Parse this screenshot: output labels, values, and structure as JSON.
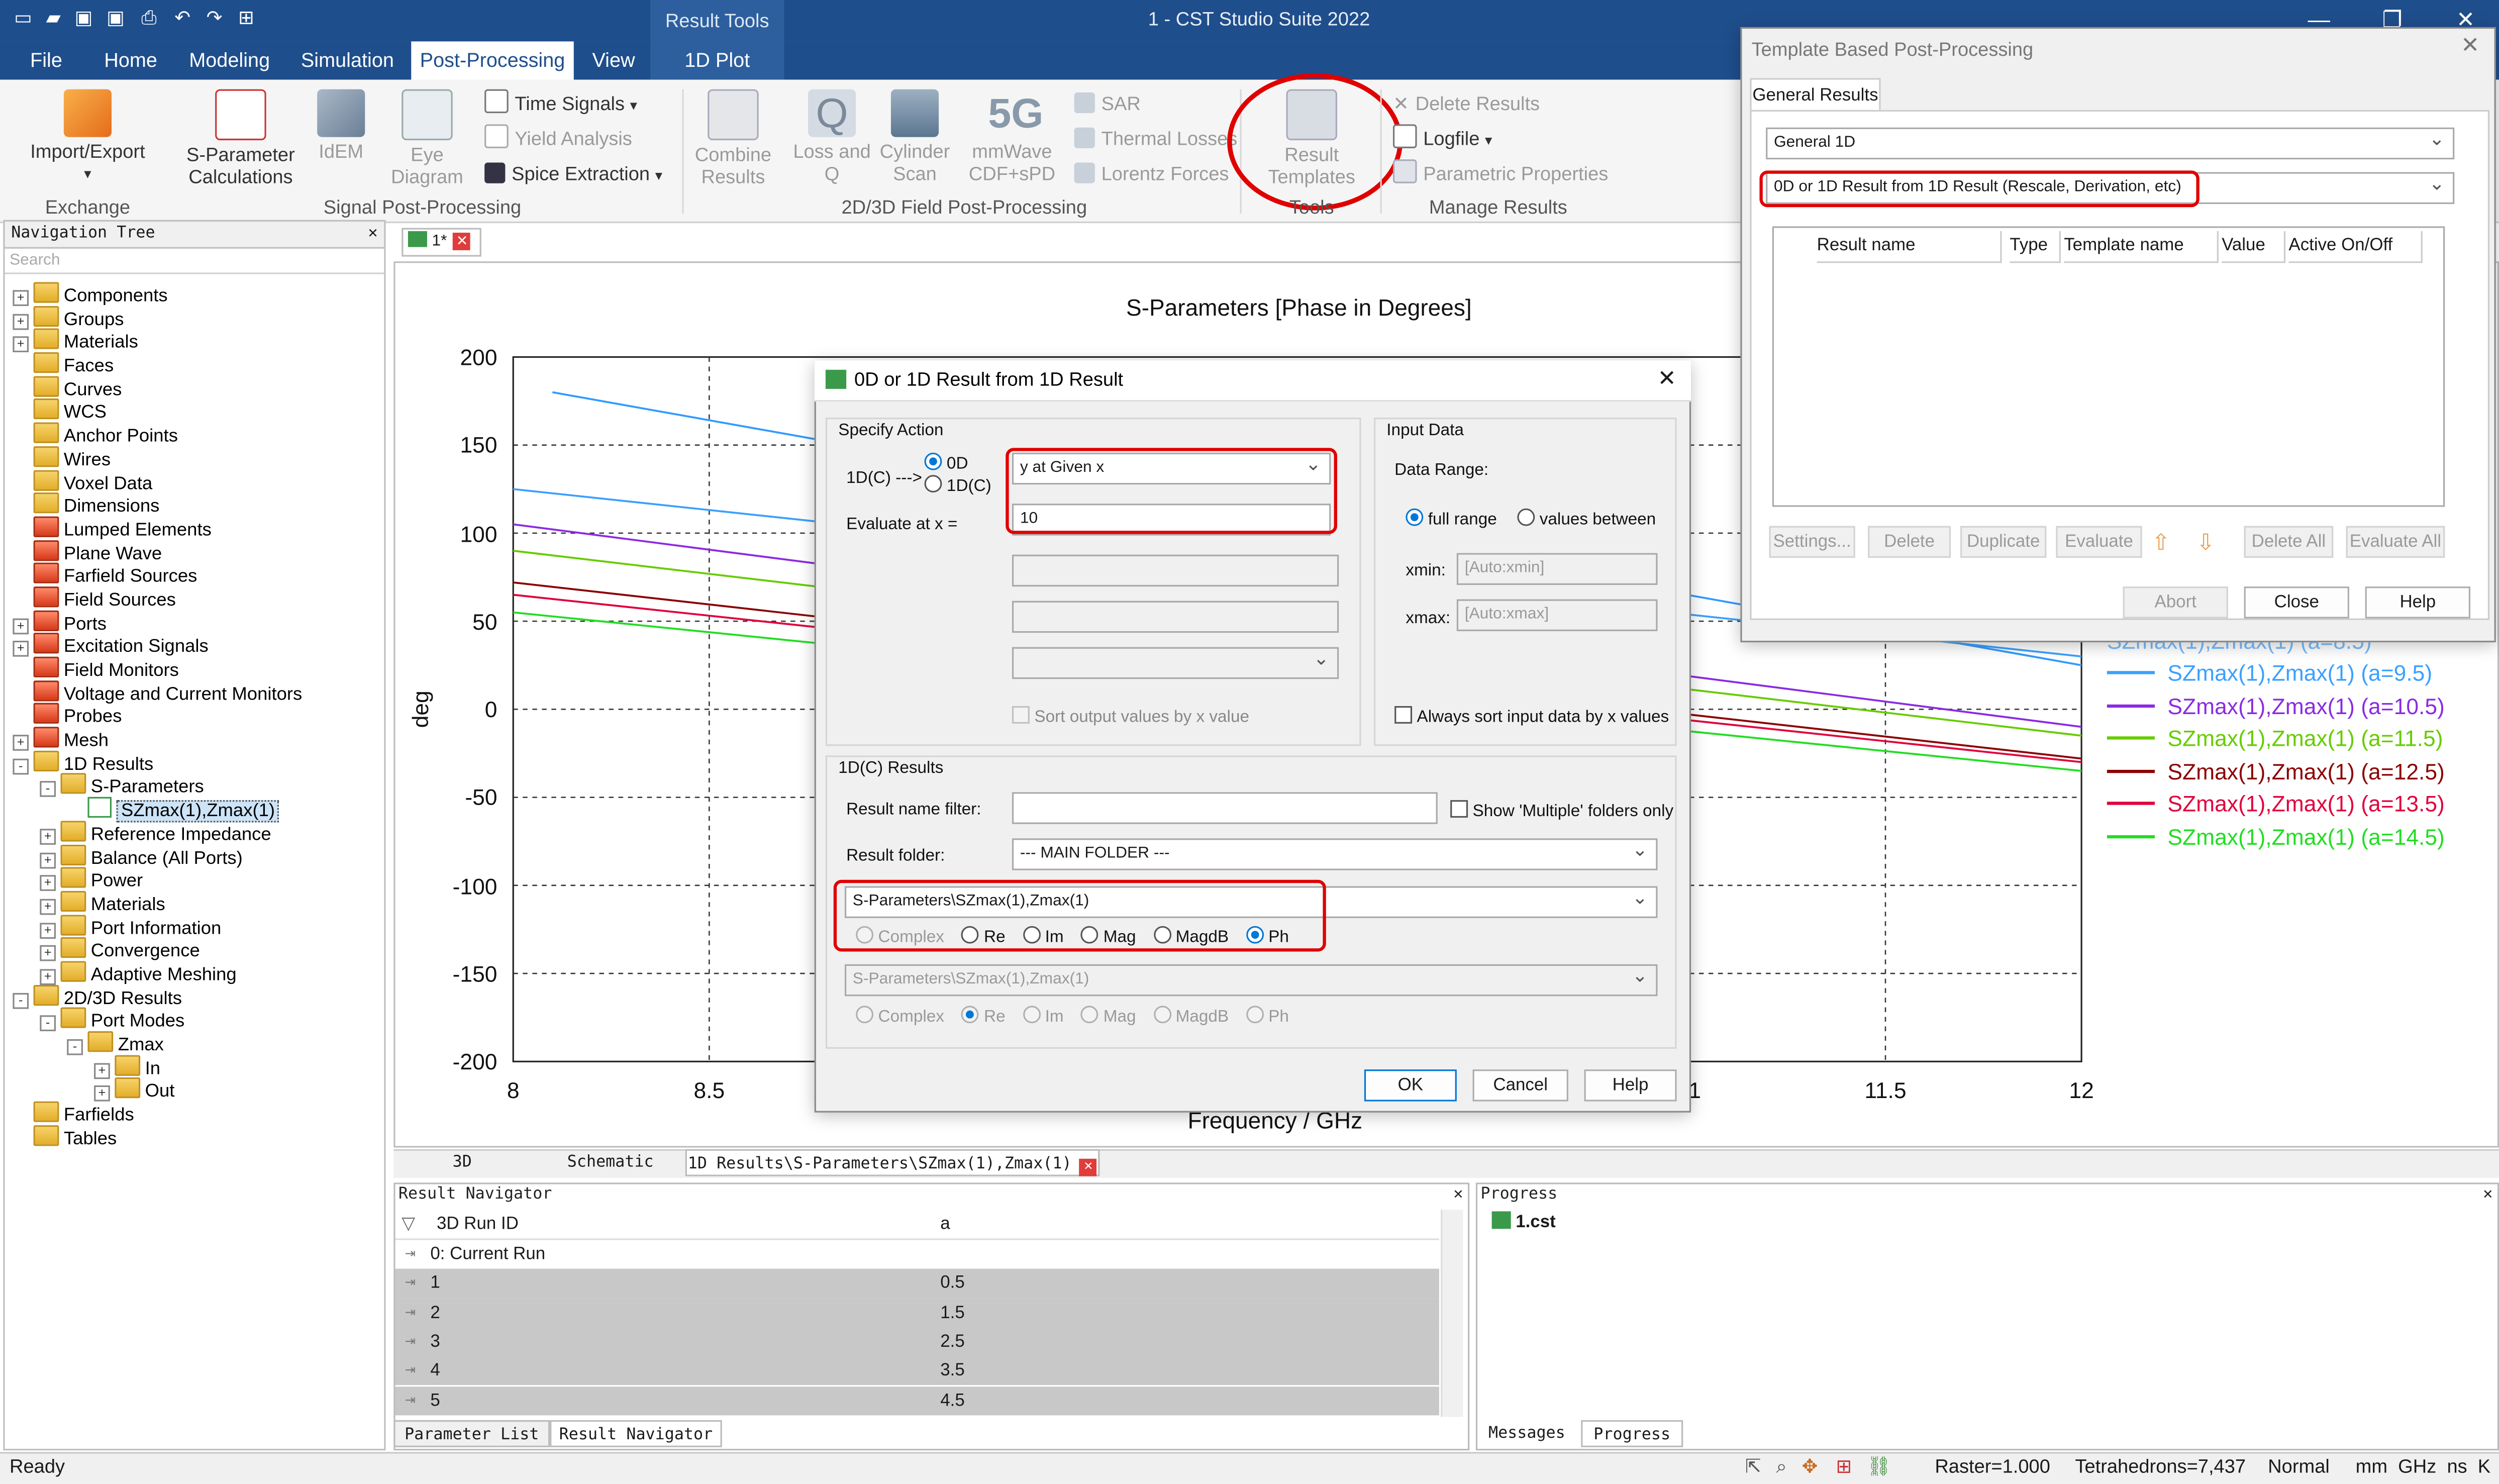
{
  "app": {
    "title": "1 - CST Studio Suite 2022",
    "context_tools": "Result Tools",
    "window_controls": [
      "minimize-icon",
      "maximize-icon",
      "close-icon"
    ]
  },
  "menu_tabs": [
    "File",
    "Home",
    "Modeling",
    "Simulation",
    "Post-Processing",
    "View",
    "1D Plot"
  ],
  "ribbon": {
    "import_export": "Import/Export",
    "s_param": "S-Parameter",
    "s_param2": "Calculations",
    "idem": "IdEM",
    "eye1": "Eye",
    "eye2": "Diagram",
    "time_signals": "Time Signals",
    "yield_analysis": "Yield Analysis",
    "spice_extraction": "Spice Extraction",
    "combine1": "Combine",
    "combine2": "Results",
    "loss1": "Loss and",
    "loss2": "Q",
    "cyl1": "Cylinder",
    "cyl2": "Scan",
    "mmwave1": "mmWave",
    "mmwave2": "CDF+sPD",
    "sar": "SAR",
    "thermal_losses": "Thermal Losses",
    "lorentz_forces": "Lorentz Forces",
    "result_templates1": "Result",
    "result_templates2": "Templates",
    "delete_results": "Delete Results",
    "logfile": "Logfile",
    "parametric_properties": "Parametric Properties",
    "groups": {
      "exchange": "Exchange",
      "signal_pp": "Signal Post-Processing",
      "field_pp": "2D/3D Field Post-Processing",
      "tools": "Tools",
      "manage": "Manage Results"
    },
    "icon_5g": "5G"
  },
  "nav_tree": {
    "title": "Navigation Tree",
    "search_placeholder": "Search",
    "items": [
      {
        "label": "Components",
        "level": 0,
        "exp": "+",
        "icon": "folder"
      },
      {
        "label": "Groups",
        "level": 0,
        "exp": "+",
        "icon": "folder"
      },
      {
        "label": "Materials",
        "level": 0,
        "exp": "+",
        "icon": "folder"
      },
      {
        "label": "Faces",
        "level": 0,
        "exp": "",
        "icon": "folder"
      },
      {
        "label": "Curves",
        "level": 0,
        "exp": "",
        "icon": "folder"
      },
      {
        "label": "WCS",
        "level": 0,
        "exp": "",
        "icon": "folder"
      },
      {
        "label": "Anchor Points",
        "level": 0,
        "exp": "",
        "icon": "folder"
      },
      {
        "label": "Wires",
        "level": 0,
        "exp": "",
        "icon": "folder"
      },
      {
        "label": "Voxel Data",
        "level": 0,
        "exp": "",
        "icon": "folder"
      },
      {
        "label": "Dimensions",
        "level": 0,
        "exp": "",
        "icon": "folder"
      },
      {
        "label": "Lumped Elements",
        "level": 0,
        "exp": "",
        "icon": "red"
      },
      {
        "label": "Plane Wave",
        "level": 0,
        "exp": "",
        "icon": "red"
      },
      {
        "label": "Farfield Sources",
        "level": 0,
        "exp": "",
        "icon": "red"
      },
      {
        "label": "Field Sources",
        "level": 0,
        "exp": "",
        "icon": "red"
      },
      {
        "label": "Ports",
        "level": 0,
        "exp": "+",
        "icon": "red"
      },
      {
        "label": "Excitation Signals",
        "level": 0,
        "exp": "+",
        "icon": "red"
      },
      {
        "label": "Field Monitors",
        "level": 0,
        "exp": "",
        "icon": "red"
      },
      {
        "label": "Voltage and Current Monitors",
        "level": 0,
        "exp": "",
        "icon": "red"
      },
      {
        "label": "Probes",
        "level": 0,
        "exp": "",
        "icon": "red"
      },
      {
        "label": "Mesh",
        "level": 0,
        "exp": "+",
        "icon": "red"
      },
      {
        "label": "1D Results",
        "level": 0,
        "exp": "-",
        "icon": "folder"
      },
      {
        "label": "S-Parameters",
        "level": 1,
        "exp": "-",
        "icon": "folder"
      },
      {
        "label": "SZmax(1),Zmax(1)",
        "level": 2,
        "exp": "",
        "icon": "curve",
        "selected": true
      },
      {
        "label": "Reference Impedance",
        "level": 1,
        "exp": "+",
        "icon": "folder"
      },
      {
        "label": "Balance (All Ports)",
        "level": 1,
        "exp": "+",
        "icon": "folder"
      },
      {
        "label": "Power",
        "level": 1,
        "exp": "+",
        "icon": "folder"
      },
      {
        "label": "Materials",
        "level": 1,
        "exp": "+",
        "icon": "folder"
      },
      {
        "label": "Port Information",
        "level": 1,
        "exp": "+",
        "icon": "folder"
      },
      {
        "label": "Convergence",
        "level": 1,
        "exp": "+",
        "icon": "folder"
      },
      {
        "label": "Adaptive Meshing",
        "level": 1,
        "exp": "+",
        "icon": "folder"
      },
      {
        "label": "2D/3D Results",
        "level": 0,
        "exp": "-",
        "icon": "folder"
      },
      {
        "label": "Port Modes",
        "level": 1,
        "exp": "-",
        "icon": "folder"
      },
      {
        "label": "Zmax",
        "level": 2,
        "exp": "-",
        "icon": "folder"
      },
      {
        "label": "In",
        "level": 3,
        "exp": "+",
        "icon": "folder"
      },
      {
        "label": "Out",
        "level": 3,
        "exp": "+",
        "icon": "folder"
      },
      {
        "label": "Farfields",
        "level": 0,
        "exp": "",
        "icon": "folder"
      },
      {
        "label": "Tables",
        "level": 0,
        "exp": "",
        "icon": "folder"
      }
    ]
  },
  "doc_tab": "1*",
  "chart_data": {
    "type": "line",
    "title": "S-Parameters [Phase in Degrees]",
    "xlabel": "Frequency / GHz",
    "ylabel": "deg",
    "xlim": [
      8,
      12
    ],
    "ylim": [
      -200,
      200
    ],
    "x_ticks": [
      "8",
      "8.5",
      "11",
      "11.5",
      "12"
    ],
    "y_ticks": [
      "200",
      "150",
      "100",
      "50",
      "0",
      "-50",
      "-100",
      "-150",
      "-200"
    ],
    "series": [
      {
        "name": "SZmax(1),Zmax(1) (a=8.5)",
        "color": "#2f9bff",
        "x": [
          8.1,
          12
        ],
        "y": [
          180,
          25
        ]
      },
      {
        "name": "SZmax(1),Zmax(1) (a=9.5)",
        "color": "#3aa0ff",
        "x": [
          8,
          12
        ],
        "y": [
          125,
          30
        ]
      },
      {
        "name": "SZmax(1),Zmax(1) (a=10.5)",
        "color": "#8a2be2",
        "x": [
          8,
          12
        ],
        "y": [
          105,
          -10
        ]
      },
      {
        "name": "SZmax(1),Zmax(1) (a=11.5)",
        "color": "#66cc00",
        "x": [
          8,
          12
        ],
        "y": [
          90,
          -15
        ]
      },
      {
        "name": "SZmax(1),Zmax(1) (a=12.5)",
        "color": "#8b0000",
        "x": [
          8,
          12
        ],
        "y": [
          72,
          -28
        ]
      },
      {
        "name": "SZmax(1),Zmax(1) (a=13.5)",
        "color": "#e0003c",
        "x": [
          8,
          12
        ],
        "y": [
          65,
          -30
        ]
      },
      {
        "name": "SZmax(1),Zmax(1) (a=14.5)",
        "color": "#22dd22",
        "x": [
          8,
          12
        ],
        "y": [
          55,
          -35
        ]
      }
    ],
    "legend_position": "right"
  },
  "bottom_tabs": [
    "3D",
    "Schematic",
    "1D Results\\S-Parameters\\SZmax(1),Zmax(1)"
  ],
  "dialog_main": {
    "title": "0D or 1D Result from 1D Result",
    "specify_action": "Specify Action",
    "io_label": "1D(C) --->",
    "opt_0d": "0D",
    "opt_1dc": "1D(C)",
    "action_select": "y at Given x",
    "evaluate_label": "Evaluate at x =",
    "evaluate_value": "10",
    "sort_output": "Sort output values by x value",
    "input_data": "Input Data",
    "data_range": "Data Range:",
    "full_range": "full range",
    "values_between": "values between",
    "xmin_label": "xmin:",
    "xmin_placeholder": "[Auto:xmin]",
    "xmax_label": "xmax:",
    "xmax_placeholder": "[Auto:xmax]",
    "always_sort": "Always sort input data by x values",
    "results_group": "1D(C) Results",
    "name_filter": "Result name filter:",
    "show_multiple": "Show 'Multiple' folders only",
    "result_folder": "Result folder:",
    "result_folder_value": "--- MAIN FOLDER ---",
    "result_1": "S-Parameters\\SZmax(1),Zmax(1)",
    "result_2": "S-Parameters\\SZmax(1),Zmax(1)",
    "complex": "Complex",
    "re": "Re",
    "im": "Im",
    "mag": "Mag",
    "magdb": "MagdB",
    "ph": "Ph",
    "ok": "OK",
    "cancel": "Cancel",
    "help": "Help"
  },
  "dialog_template": {
    "title": "Template Based Post-Processing",
    "tab": "General Results",
    "category_select": "General 1D",
    "template_select": "0D or 1D Result from 1D Result (Rescale, Derivation, etc)",
    "columns": [
      "Result name",
      "Type",
      "Template name",
      "Value",
      "Active On/Off"
    ],
    "buttons": [
      "Settings...",
      "Delete",
      "Duplicate",
      "Evaluate",
      "Delete All",
      "Evaluate All"
    ],
    "abort": "Abort",
    "close": "Close",
    "help": "Help"
  },
  "legend_partial": "SZmax(1),Zmax(1) (a=8.5)",
  "result_navigator": {
    "title": "Result Navigator",
    "columns": [
      "3D Run ID",
      "a"
    ],
    "rows": [
      {
        "id": "0: Current Run",
        "a": "",
        "sel": false
      },
      {
        "id": "1",
        "a": "0.5",
        "sel": true
      },
      {
        "id": "2",
        "a": "1.5",
        "sel": true
      },
      {
        "id": "3",
        "a": "2.5",
        "sel": true
      },
      {
        "id": "4",
        "a": "3.5",
        "sel": true
      },
      {
        "id": "5",
        "a": "4.5",
        "sel": true
      }
    ],
    "tabs": [
      "Parameter List",
      "Result Navigator"
    ]
  },
  "progress": {
    "title": "Progress",
    "item": "1.cst",
    "tabs": [
      "Messages",
      "Progress"
    ]
  },
  "status": {
    "ready": "Ready",
    "raster": "Raster=1.000",
    "tetra": "Tetrahedrons=7,437",
    "mode": "Normal",
    "units": "mm  GHz  ns  K"
  }
}
